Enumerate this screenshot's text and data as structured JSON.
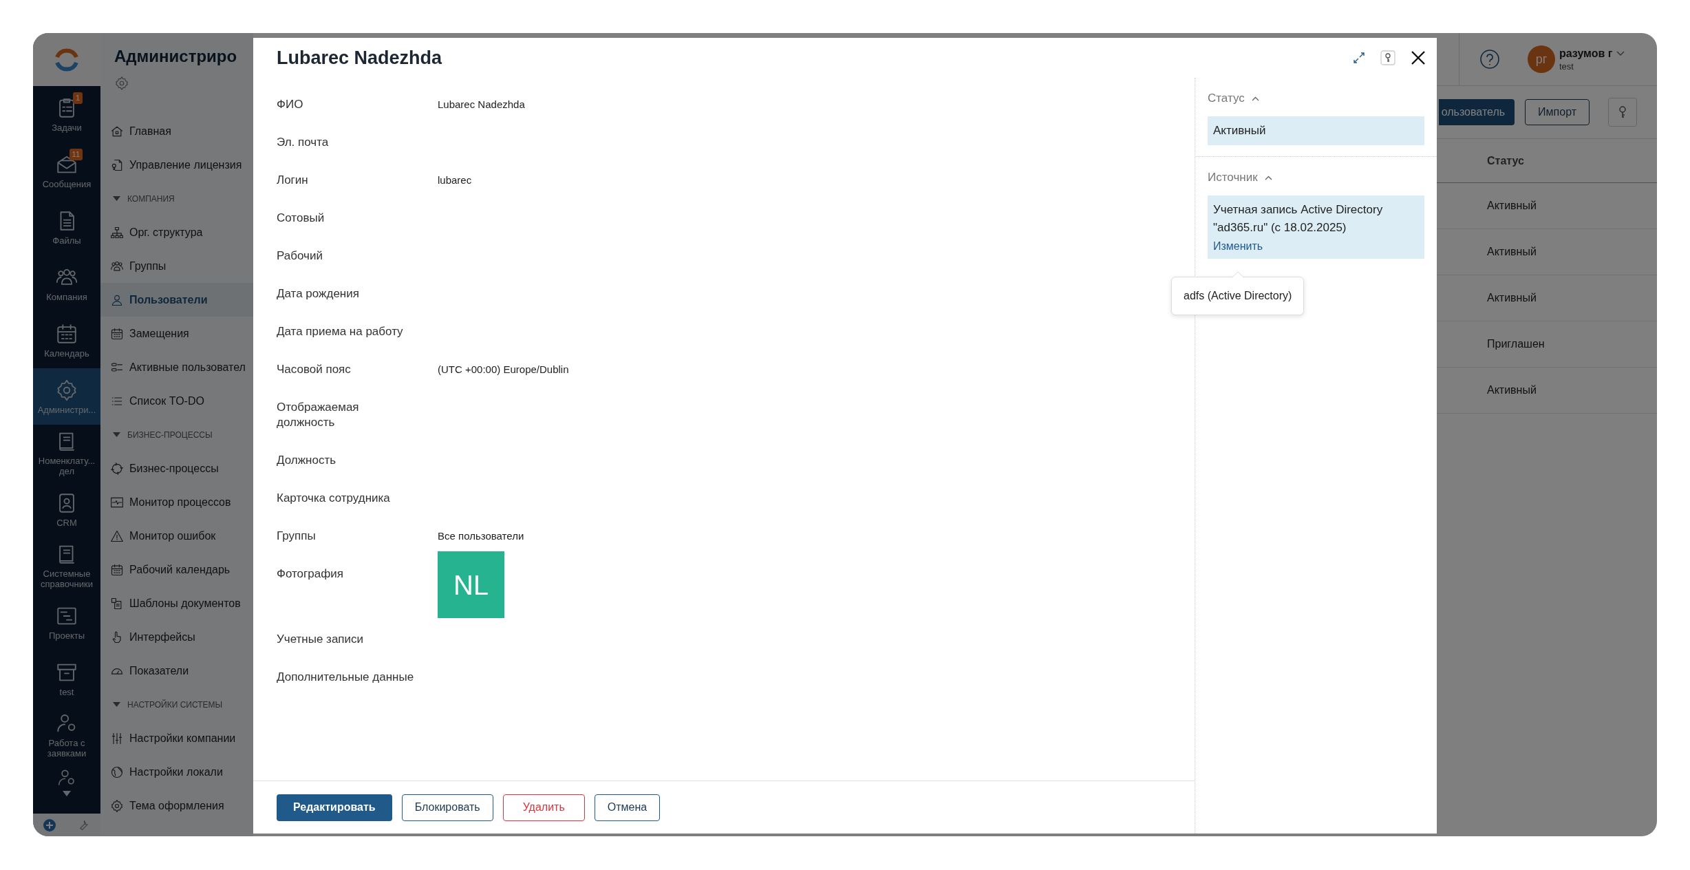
{
  "rail": {
    "items": [
      {
        "label": "Задачи",
        "badge": "1",
        "selected": false
      },
      {
        "label": "Сообщения",
        "badge": "11",
        "selected": false
      },
      {
        "label": "Файлы",
        "selected": false
      },
      {
        "label": "Компания",
        "selected": false
      },
      {
        "label": "Календарь",
        "selected": false
      },
      {
        "label": "Администри...",
        "selected": true
      },
      {
        "label": "Номенклату... дел",
        "selected": false
      },
      {
        "label": "CRM",
        "selected": false
      },
      {
        "label": "Системные справочники",
        "selected": false
      },
      {
        "label": "Проекты",
        "selected": false
      },
      {
        "label": "test",
        "selected": false
      },
      {
        "label": "Работа с заявками",
        "selected": false
      }
    ]
  },
  "nav": {
    "title": "Администриро",
    "items": [
      {
        "kind": "link",
        "label": "Главная",
        "selected": false
      },
      {
        "kind": "link",
        "label": "Управление лицензия",
        "selected": false
      },
      {
        "kind": "section",
        "label": "КОМПАНИЯ",
        "expanded": true
      },
      {
        "kind": "link",
        "label": "Орг. структура",
        "selected": false
      },
      {
        "kind": "link",
        "label": "Группы",
        "selected": false
      },
      {
        "kind": "link",
        "label": "Пользователи",
        "selected": true
      },
      {
        "kind": "link",
        "label": "Замещения",
        "selected": false
      },
      {
        "kind": "link",
        "label": "Активные пользовател",
        "selected": false
      },
      {
        "kind": "link",
        "label": "Список TO-DO",
        "selected": false
      },
      {
        "kind": "section",
        "label": "БИЗНЕС-ПРОЦЕССЫ",
        "expanded": true
      },
      {
        "kind": "link",
        "label": "Бизнес-процессы",
        "selected": false
      },
      {
        "kind": "link",
        "label": "Монитор процессов",
        "selected": false
      },
      {
        "kind": "link",
        "label": "Монитор ошибок",
        "selected": false
      },
      {
        "kind": "link",
        "label": "Рабочий календарь",
        "selected": false
      },
      {
        "kind": "link",
        "label": "Шаблоны документов",
        "selected": false
      },
      {
        "kind": "link",
        "label": "Интерфейсы",
        "selected": false
      },
      {
        "kind": "link",
        "label": "Показатели",
        "selected": false
      },
      {
        "kind": "section",
        "label": "НАСТРОЙКИ СИСТЕМЫ",
        "expanded": true
      },
      {
        "kind": "link",
        "label": "Настройки компании",
        "selected": false
      },
      {
        "kind": "link",
        "label": "Настройки локали",
        "selected": false
      },
      {
        "kind": "link",
        "label": "Тема оформления",
        "selected": false
      }
    ]
  },
  "topbar": {
    "avatar": "рг",
    "user_name": "разумов г",
    "user_sub": "test"
  },
  "toolbar": {
    "buttons": [
      {
        "label": "ользователь",
        "kind": "primary"
      },
      {
        "label": "Импорт",
        "kind": "outline"
      }
    ]
  },
  "table": {
    "columns": [
      "Статус"
    ],
    "rows": [
      [
        "Активный"
      ],
      [
        "Активный"
      ],
      [
        "Активный"
      ],
      [
        "Приглашен"
      ],
      [
        "Активный"
      ]
    ]
  },
  "modal": {
    "title": "Lubarec Nadezhda",
    "fields": [
      {
        "kind": "text",
        "label": "ФИО",
        "value": "Lubarec Nadezhda"
      },
      {
        "kind": "text",
        "label": "Эл. почта"
      },
      {
        "kind": "text",
        "label": "Логин",
        "value": "lubarec"
      },
      {
        "kind": "text",
        "label": "Сотовый"
      },
      {
        "kind": "text",
        "label": "Рабочий"
      },
      {
        "kind": "text",
        "label": "Дата рождения"
      },
      {
        "kind": "text",
        "label": "Дата приема на работу"
      },
      {
        "kind": "text",
        "label": "Часовой пояс",
        "value": "(UTC +00:00) Europe/Dublin"
      },
      {
        "kind": "text",
        "label": "Отображаемая должность"
      },
      {
        "kind": "text",
        "label": "Должность"
      },
      {
        "kind": "text",
        "label": "Карточка сотрудника"
      },
      {
        "kind": "text",
        "label": "Группы",
        "value": "Все пользователи"
      },
      {
        "kind": "photo",
        "label": "Фотография",
        "initials": "NL"
      },
      {
        "kind": "text",
        "label": "Учетные записи"
      },
      {
        "kind": "text",
        "label": "Дополнительные данные"
      }
    ],
    "sections": [
      {
        "title": "Статус",
        "expanded": true,
        "text": "Активный"
      },
      {
        "title": "Источник",
        "expanded": true,
        "text": "Учетная запись Active Directory \"ad365.ru\" (с 18.02.2025)",
        "link": "Изменить"
      }
    ],
    "tooltip": "adfs (Active Directory)",
    "buttons": [
      {
        "label": "Редактировать",
        "kind": "primary"
      },
      {
        "label": "Блокировать",
        "kind": "outline"
      },
      {
        "label": "Удалить",
        "kind": "danger"
      },
      {
        "label": "Отмена",
        "kind": "outline"
      }
    ]
  }
}
